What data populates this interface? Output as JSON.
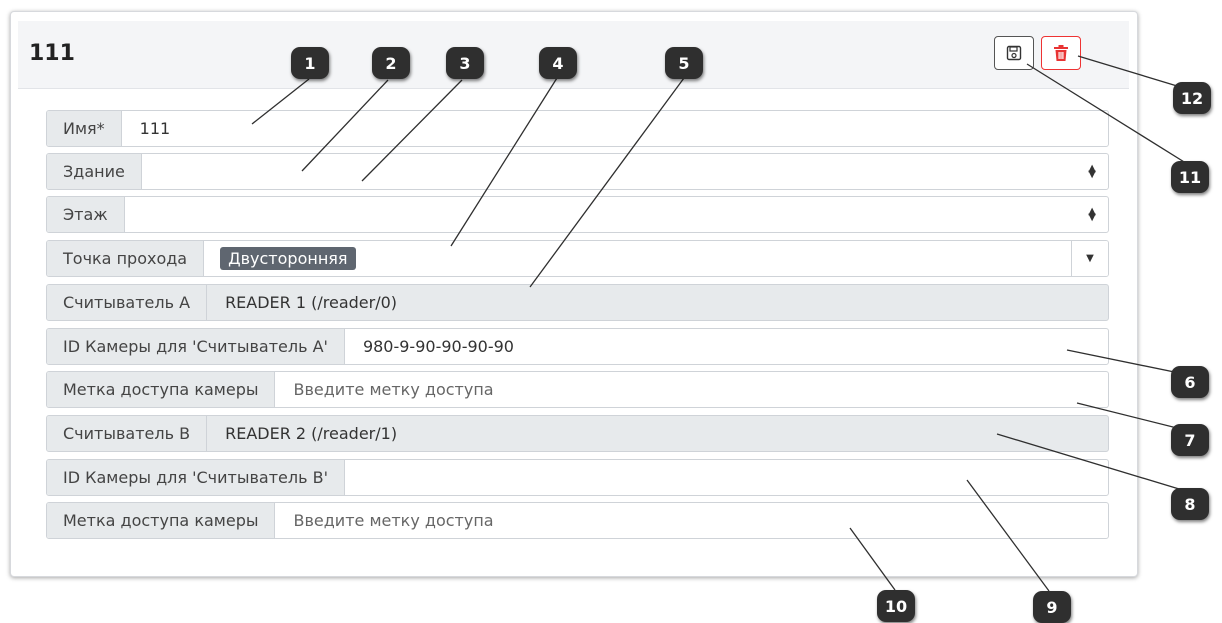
{
  "card": {
    "title": "111"
  },
  "buttons": {
    "save_icon": "save-icon",
    "delete_icon": "trash-icon",
    "delete_color": "#e83333"
  },
  "fields": [
    {
      "label": "Имя*",
      "value": "111",
      "type": "input"
    },
    {
      "label": "Здание",
      "value": "",
      "type": "select"
    },
    {
      "label": "Этаж",
      "value": "",
      "type": "select"
    },
    {
      "label": "Точка прохода",
      "value": "Двусторонняя",
      "type": "dropdown-tag"
    },
    {
      "label": "Считыватель A",
      "value": "READER 1 (/reader/0)",
      "type": "readonly"
    },
    {
      "label": "ID Камеры для 'Считыватель A'",
      "value": "980-9-90-90-90-90",
      "type": "input"
    },
    {
      "label": "Метка доступа камеры",
      "placeholder": "Введите метку доступа",
      "type": "input"
    },
    {
      "label": "Считыватель B",
      "value": "READER 2 (/reader/1)",
      "type": "readonly"
    },
    {
      "label": "ID Камеры для 'Считыватель B'",
      "value": "",
      "type": "input"
    },
    {
      "label": "Метка доступа камеры",
      "placeholder": "Введите метку доступа",
      "type": "input"
    }
  ],
  "callouts": [
    "1",
    "2",
    "3",
    "4",
    "5",
    "6",
    "7",
    "8",
    "9",
    "10",
    "11",
    "12"
  ]
}
